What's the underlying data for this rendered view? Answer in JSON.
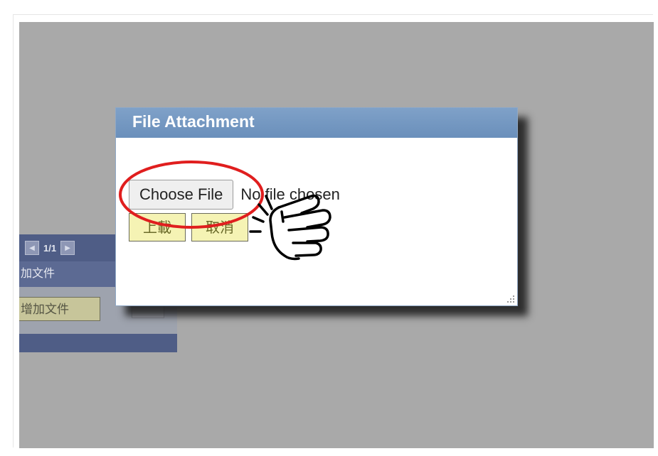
{
  "background": {
    "pager": {
      "page_text": "1/1"
    },
    "header_label": "加文件",
    "add_button_label": "增加文件"
  },
  "dialog": {
    "title": "File Attachment",
    "choose_button_label": "Choose File",
    "file_status": "No file chosen",
    "upload_button_label": "上載",
    "cancel_button_label": "取消"
  },
  "colors": {
    "overlay": "#a9a9a9",
    "dialog_titlebar": "#7596c0",
    "annotation_circle": "#e01e1e",
    "yellow_button": "#f5f3b4"
  },
  "icons": {
    "annotation": "red-ellipse-highlight",
    "pointer": "pointing-hand-click-icon"
  }
}
